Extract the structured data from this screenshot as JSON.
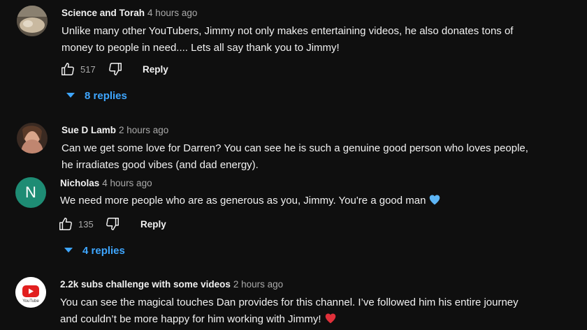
{
  "comments": [
    {
      "author": "Science and Torah",
      "time": "4 hours ago",
      "text": "Unlike many other YouTubers, Jimmy not only makes entertaining videos, he also donates tons of",
      "text2": "money to people in need.... Lets all say thank you to Jimmy!",
      "likes": "517",
      "reply": "Reply",
      "replies": "8 replies"
    },
    {
      "author": "Sue D Lamb",
      "time": "2 hours ago",
      "text": "Can we get some love for Darren? You can see he is such a genuine good person who loves people,",
      "text2": "he irradiates good vibes (and dad energy)."
    },
    {
      "author": "Nicholas",
      "time": "4 hours ago",
      "avatar_letter": "N",
      "text": "We need more people who are as generous as you, Jimmy. You're a good man",
      "likes": "135",
      "reply": "Reply",
      "replies": "4 replies"
    },
    {
      "author": "2.2k subs challenge with some videos",
      "time": "2 hours ago",
      "avatar_caption": "YouTube",
      "text": "You can see the magical touches Dan provides for this channel. I’ve followed him his entire journey",
      "text2": "and couldn’t be more happy for him working with Jimmy!"
    }
  ],
  "colors": {
    "background": "#0f0f0f",
    "link_blue": "#3ea6ff",
    "nicholas_avatar": "#1e8c74",
    "heart_blue": "#5db5f5",
    "heart_red": "#e0303a"
  },
  "icons": [
    "thumbs-up-icon",
    "thumbs-down-icon",
    "caret-down-icon",
    "blue-heart-emoji",
    "red-heart-emoji",
    "youtube-play-icon"
  ]
}
